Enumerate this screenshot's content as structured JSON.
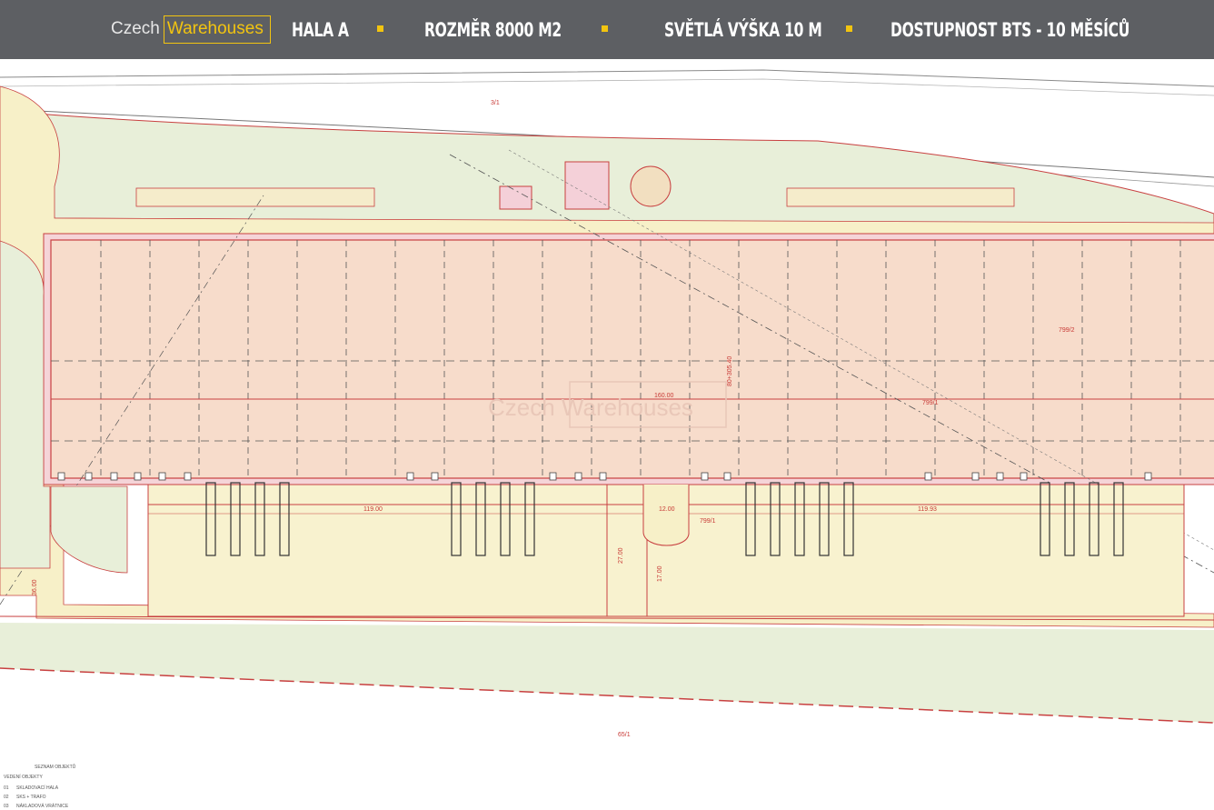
{
  "header": {
    "logo": {
      "part1": "Czech",
      "part2": "Warehouses"
    },
    "items": [
      {
        "label": "HALA A"
      },
      {
        "label": "ROZMĚR 8000 M2"
      },
      {
        "label": "SVĚTLÁ VÝŠKA  10 M"
      },
      {
        "label": "DOSTUPNOST BTS - 10 MĚSÍCŮ"
      }
    ],
    "bullet_color": "#f2c410"
  },
  "plan": {
    "watermark": "Czech Warehouses",
    "labels": {
      "parcel_top": "3/1",
      "parcel_mid1": "799/2",
      "parcel_mid2": "799/1",
      "parcel_low": "799/1",
      "dim_long": "80+305.40",
      "dim_hall": "160.00",
      "dim_height": "12.00",
      "dim_span_left": "119.00",
      "dim_span_right": "119.93",
      "dim_yard_a": "27.00",
      "dim_yard_b": "17.00",
      "dim_left": "36.00",
      "dim_bottom": "65/1"
    },
    "legend": {
      "title": "SEZNAM OBJEKTŮ",
      "subtitle": "VEDENÍ OBJEKTY",
      "rows": [
        {
          "code": "01",
          "name": "SKLADOVACÍ HALA"
        },
        {
          "code": "02",
          "name": "SKS + TRAFO"
        },
        {
          "code": "03",
          "name": "NÁKLADOVÁ VRÁTNICE"
        }
      ]
    }
  }
}
